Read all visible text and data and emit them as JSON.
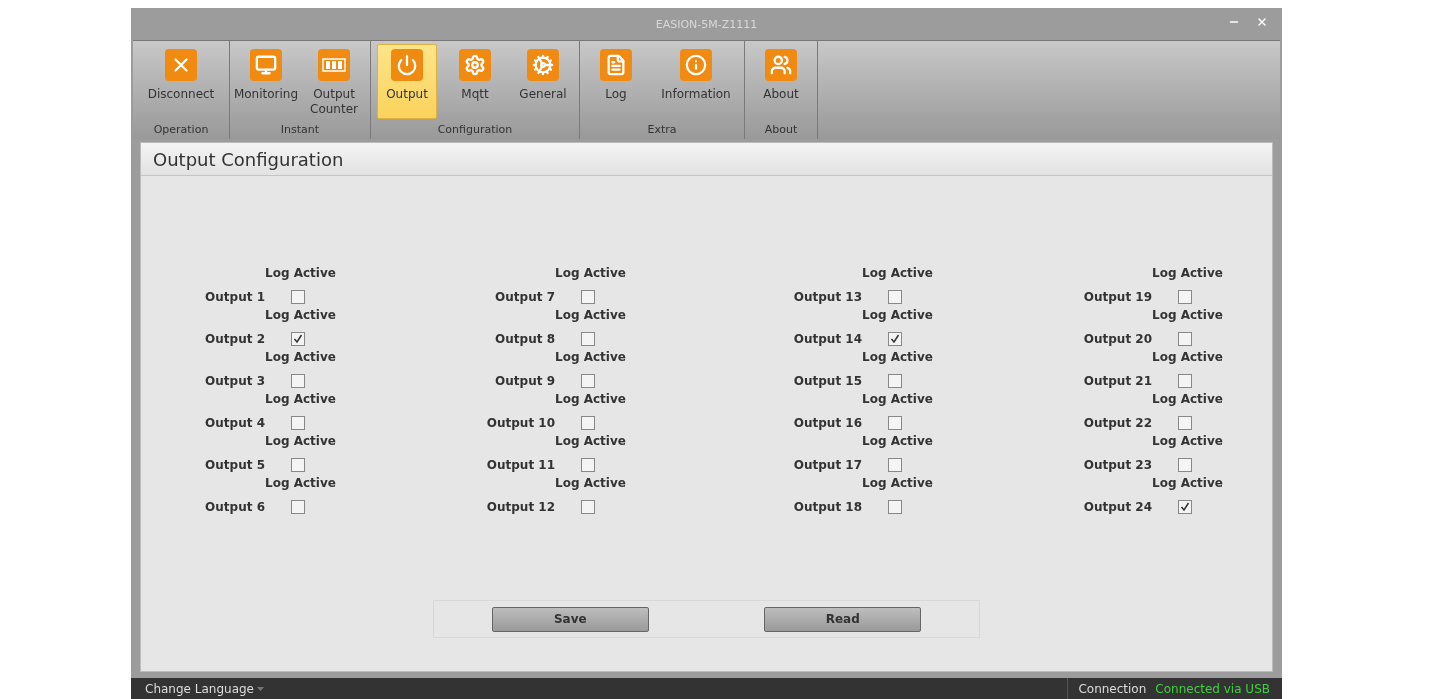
{
  "window": {
    "title": "EASION-5M-Z1111"
  },
  "ribbon": {
    "groups": [
      {
        "label": "Operation",
        "buttons": [
          {
            "kind": "disconnect",
            "label": "Disconnect",
            "selected": false
          }
        ]
      },
      {
        "label": "Instant",
        "buttons": [
          {
            "kind": "monitoring",
            "label": "Monitoring",
            "selected": false
          },
          {
            "kind": "counter",
            "label": "Output Counter",
            "selected": false
          }
        ]
      },
      {
        "label": "Configuration",
        "buttons": [
          {
            "kind": "output",
            "label": "Output",
            "selected": true
          },
          {
            "kind": "mqtt",
            "label": "Mqtt",
            "selected": false
          },
          {
            "kind": "general",
            "label": "General",
            "selected": false
          }
        ]
      },
      {
        "label": "Extra",
        "buttons": [
          {
            "kind": "log",
            "label": "Log",
            "selected": false
          },
          {
            "kind": "information",
            "label": "Information",
            "selected": false
          }
        ]
      },
      {
        "label": "About",
        "buttons": [
          {
            "kind": "about",
            "label": "About",
            "selected": false
          }
        ]
      }
    ]
  },
  "panel": {
    "title": "Output Configuration",
    "columns": [
      {
        "outputs": [
          {
            "label": "Output 1",
            "log_label": "Log Active",
            "checked": false
          },
          {
            "label": "Output 2",
            "log_label": "Log Active",
            "checked": true
          },
          {
            "label": "Output 3",
            "log_label": "Log Active",
            "checked": false
          },
          {
            "label": "Output 4",
            "log_label": "Log Active",
            "checked": false
          },
          {
            "label": "Output 5",
            "log_label": "Log Active",
            "checked": false
          },
          {
            "label": "Output 6",
            "log_label": "Log Active",
            "checked": false
          }
        ]
      },
      {
        "outputs": [
          {
            "label": "Output 7",
            "log_label": "Log Active",
            "checked": false
          },
          {
            "label": "Output 8",
            "log_label": "Log Active",
            "checked": false
          },
          {
            "label": "Output 9",
            "log_label": "Log Active",
            "checked": false
          },
          {
            "label": "Output 10",
            "log_label": "Log Active",
            "checked": false
          },
          {
            "label": "Output 11",
            "log_label": "Log Active",
            "checked": false
          },
          {
            "label": "Output 12",
            "log_label": "Log Active",
            "checked": false
          }
        ]
      },
      {
        "outputs": [
          {
            "label": "Output 13",
            "log_label": "Log Active",
            "checked": false
          },
          {
            "label": "Output 14",
            "log_label": "Log Active",
            "checked": true
          },
          {
            "label": "Output 15",
            "log_label": "Log Active",
            "checked": false
          },
          {
            "label": "Output 16",
            "log_label": "Log Active",
            "checked": false
          },
          {
            "label": "Output 17",
            "log_label": "Log Active",
            "checked": false
          },
          {
            "label": "Output 18",
            "log_label": "Log Active",
            "checked": false
          }
        ]
      },
      {
        "outputs": [
          {
            "label": "Output 19",
            "log_label": "Log Active",
            "checked": false
          },
          {
            "label": "Output 20",
            "log_label": "Log Active",
            "checked": false
          },
          {
            "label": "Output 21",
            "log_label": "Log Active",
            "checked": false
          },
          {
            "label": "Output 22",
            "log_label": "Log Active",
            "checked": false
          },
          {
            "label": "Output 23",
            "log_label": "Log Active",
            "checked": false
          },
          {
            "label": "Output 24",
            "log_label": "Log Active",
            "checked": true
          }
        ]
      }
    ],
    "buttons": [
      "Save",
      "Read"
    ]
  },
  "status_bar": {
    "language": "Change Language",
    "connection_label": "Connection",
    "connection_status": "Connected via USB"
  }
}
